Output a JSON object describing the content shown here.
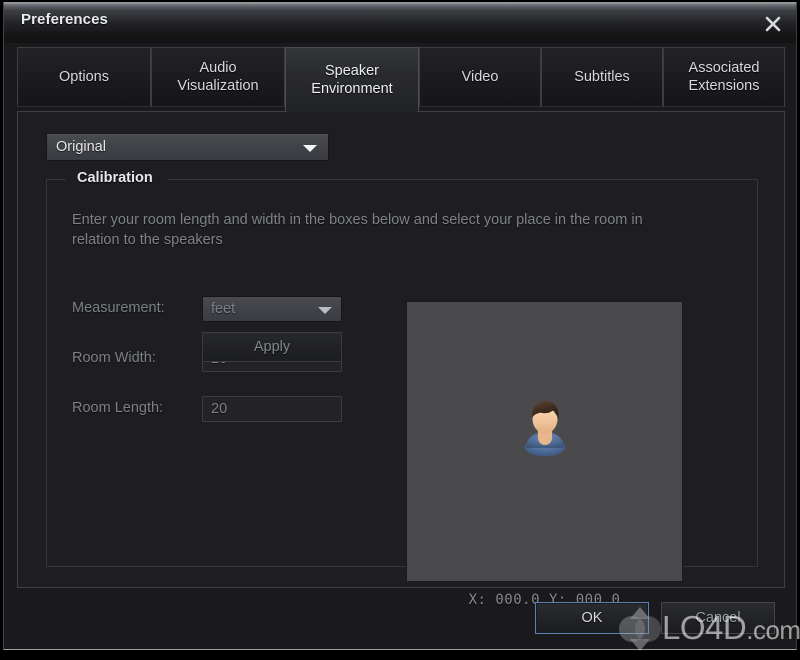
{
  "window": {
    "title": "Preferences",
    "close_icon": "close-icon"
  },
  "tabs": [
    {
      "label": "Options",
      "active": false
    },
    {
      "label": "Audio\nVisualization",
      "active": false
    },
    {
      "label": "Speaker\nEnvironment",
      "active": true
    },
    {
      "label": "Video",
      "active": false
    },
    {
      "label": "Subtitles",
      "active": false
    },
    {
      "label": "Associated\nExtensions",
      "active": false
    }
  ],
  "preset": {
    "value": "Original",
    "caret_icon": "chevron-down-icon"
  },
  "calibration": {
    "legend": "Calibration",
    "description": "Enter your room length and width in the boxes below and select your place in the room in relation to the speakers",
    "fields": {
      "measurement_label": "Measurement:",
      "measurement_value": "feet",
      "room_width_label": "Room Width:",
      "room_width_value": "20",
      "room_length_label": "Room Length:",
      "room_length_value": "20"
    },
    "apply_label": "Apply"
  },
  "room": {
    "avatar_icon": "person-avatar-icon",
    "coordinates": "X: 000.0   Y: 000.0"
  },
  "footer": {
    "ok_label": "OK",
    "cancel_label": "Cancel"
  },
  "watermark": {
    "text": "LO4D",
    "suffix": ".com"
  },
  "colors": {
    "window_bg": "#1a1a1c",
    "panel_bg": "#1e1e21",
    "room_bg": "#4a4a4c",
    "text_primary": "#e4e6ea",
    "text_muted": "#7c8086",
    "focus_blue": "#5b7fb0",
    "avatar_hair": "#4a3526",
    "avatar_skin": "#f4c9a0",
    "avatar_shirt": "#4d6a96"
  }
}
